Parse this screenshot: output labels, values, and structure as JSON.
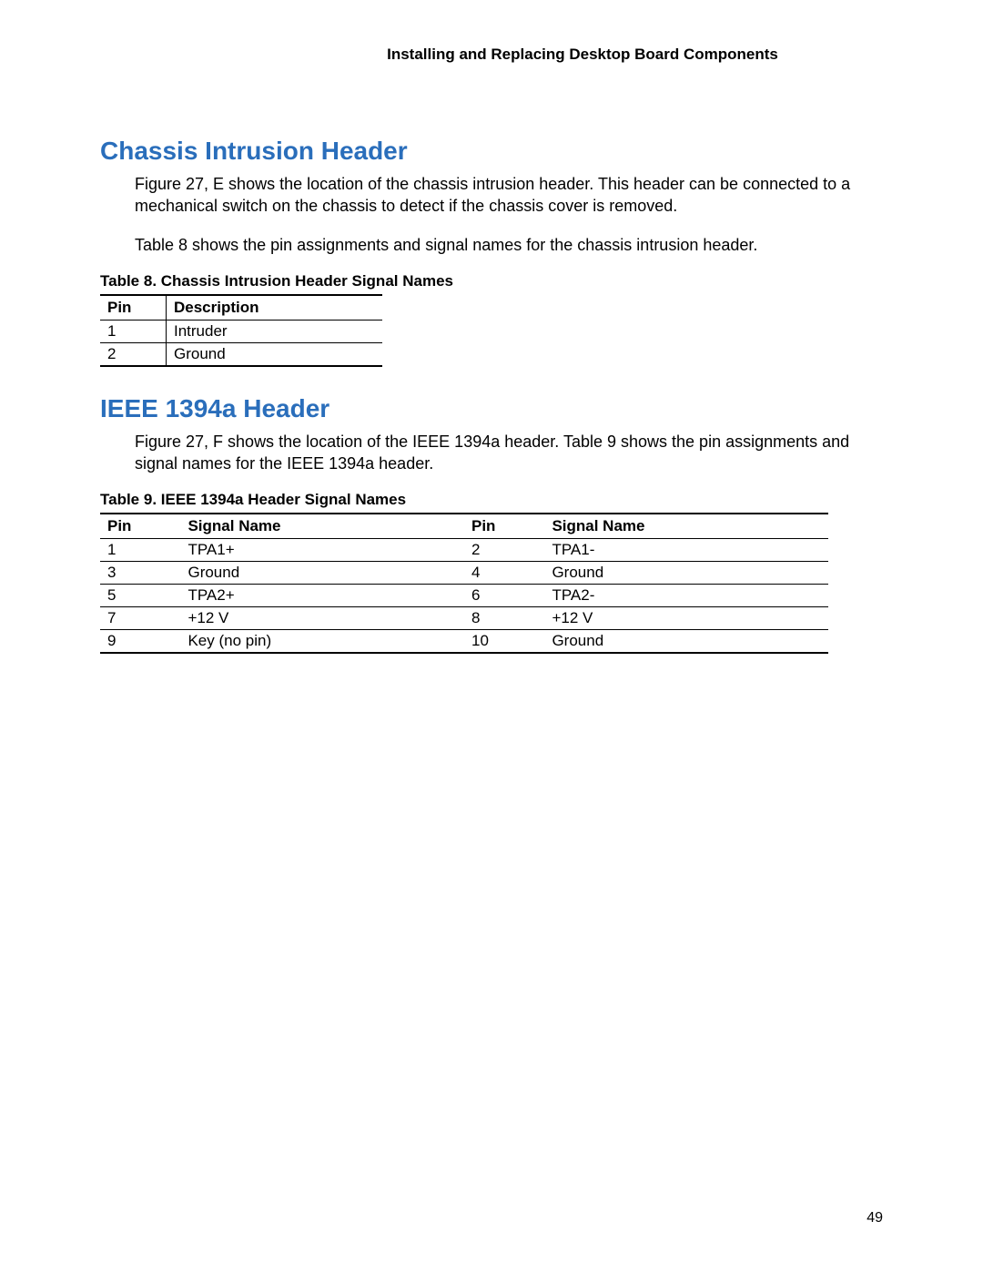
{
  "header": "Installing and Replacing Desktop Board Components",
  "section1": {
    "heading": "Chassis Intrusion Header",
    "para1": "Figure 27, E shows the location of the chassis intrusion header.  This header can be connected to a mechanical switch on the chassis to detect if the chassis cover is removed.",
    "para2": "Table 8 shows the pin assignments and signal names for the chassis intrusion header.",
    "tableCaption": "Table 8.  Chassis Intrusion Header Signal Names",
    "table": {
      "headers": {
        "pin": "Pin",
        "desc": "Description"
      },
      "rows": [
        {
          "pin": "1",
          "desc": "Intruder"
        },
        {
          "pin": "2",
          "desc": "Ground"
        }
      ]
    }
  },
  "section2": {
    "heading": "IEEE 1394a Header",
    "para1": "Figure 27, F shows the location of the IEEE 1394a header.  Table 9 shows the pin assignments and signal names for the IEEE 1394a header.",
    "tableCaption": "Table 9.  IEEE 1394a Header Signal Names",
    "table": {
      "headers": {
        "pinA": "Pin",
        "sigA": "Signal Name",
        "pinB": "Pin",
        "sigB": "Signal Name"
      },
      "rows": [
        {
          "pinA": "1",
          "sigA": "TPA1+",
          "pinB": "2",
          "sigB": "TPA1-"
        },
        {
          "pinA": "3",
          "sigA": "Ground",
          "pinB": "4",
          "sigB": "Ground"
        },
        {
          "pinA": "5",
          "sigA": "TPA2+",
          "pinB": "6",
          "sigB": "TPA2-"
        },
        {
          "pinA": "7",
          "sigA": "+12 V",
          "pinB": "8",
          "sigB": "+12 V"
        },
        {
          "pinA": "9",
          "sigA": "Key (no pin)",
          "pinB": "10",
          "sigB": "Ground"
        }
      ]
    }
  },
  "pageNumber": "49"
}
